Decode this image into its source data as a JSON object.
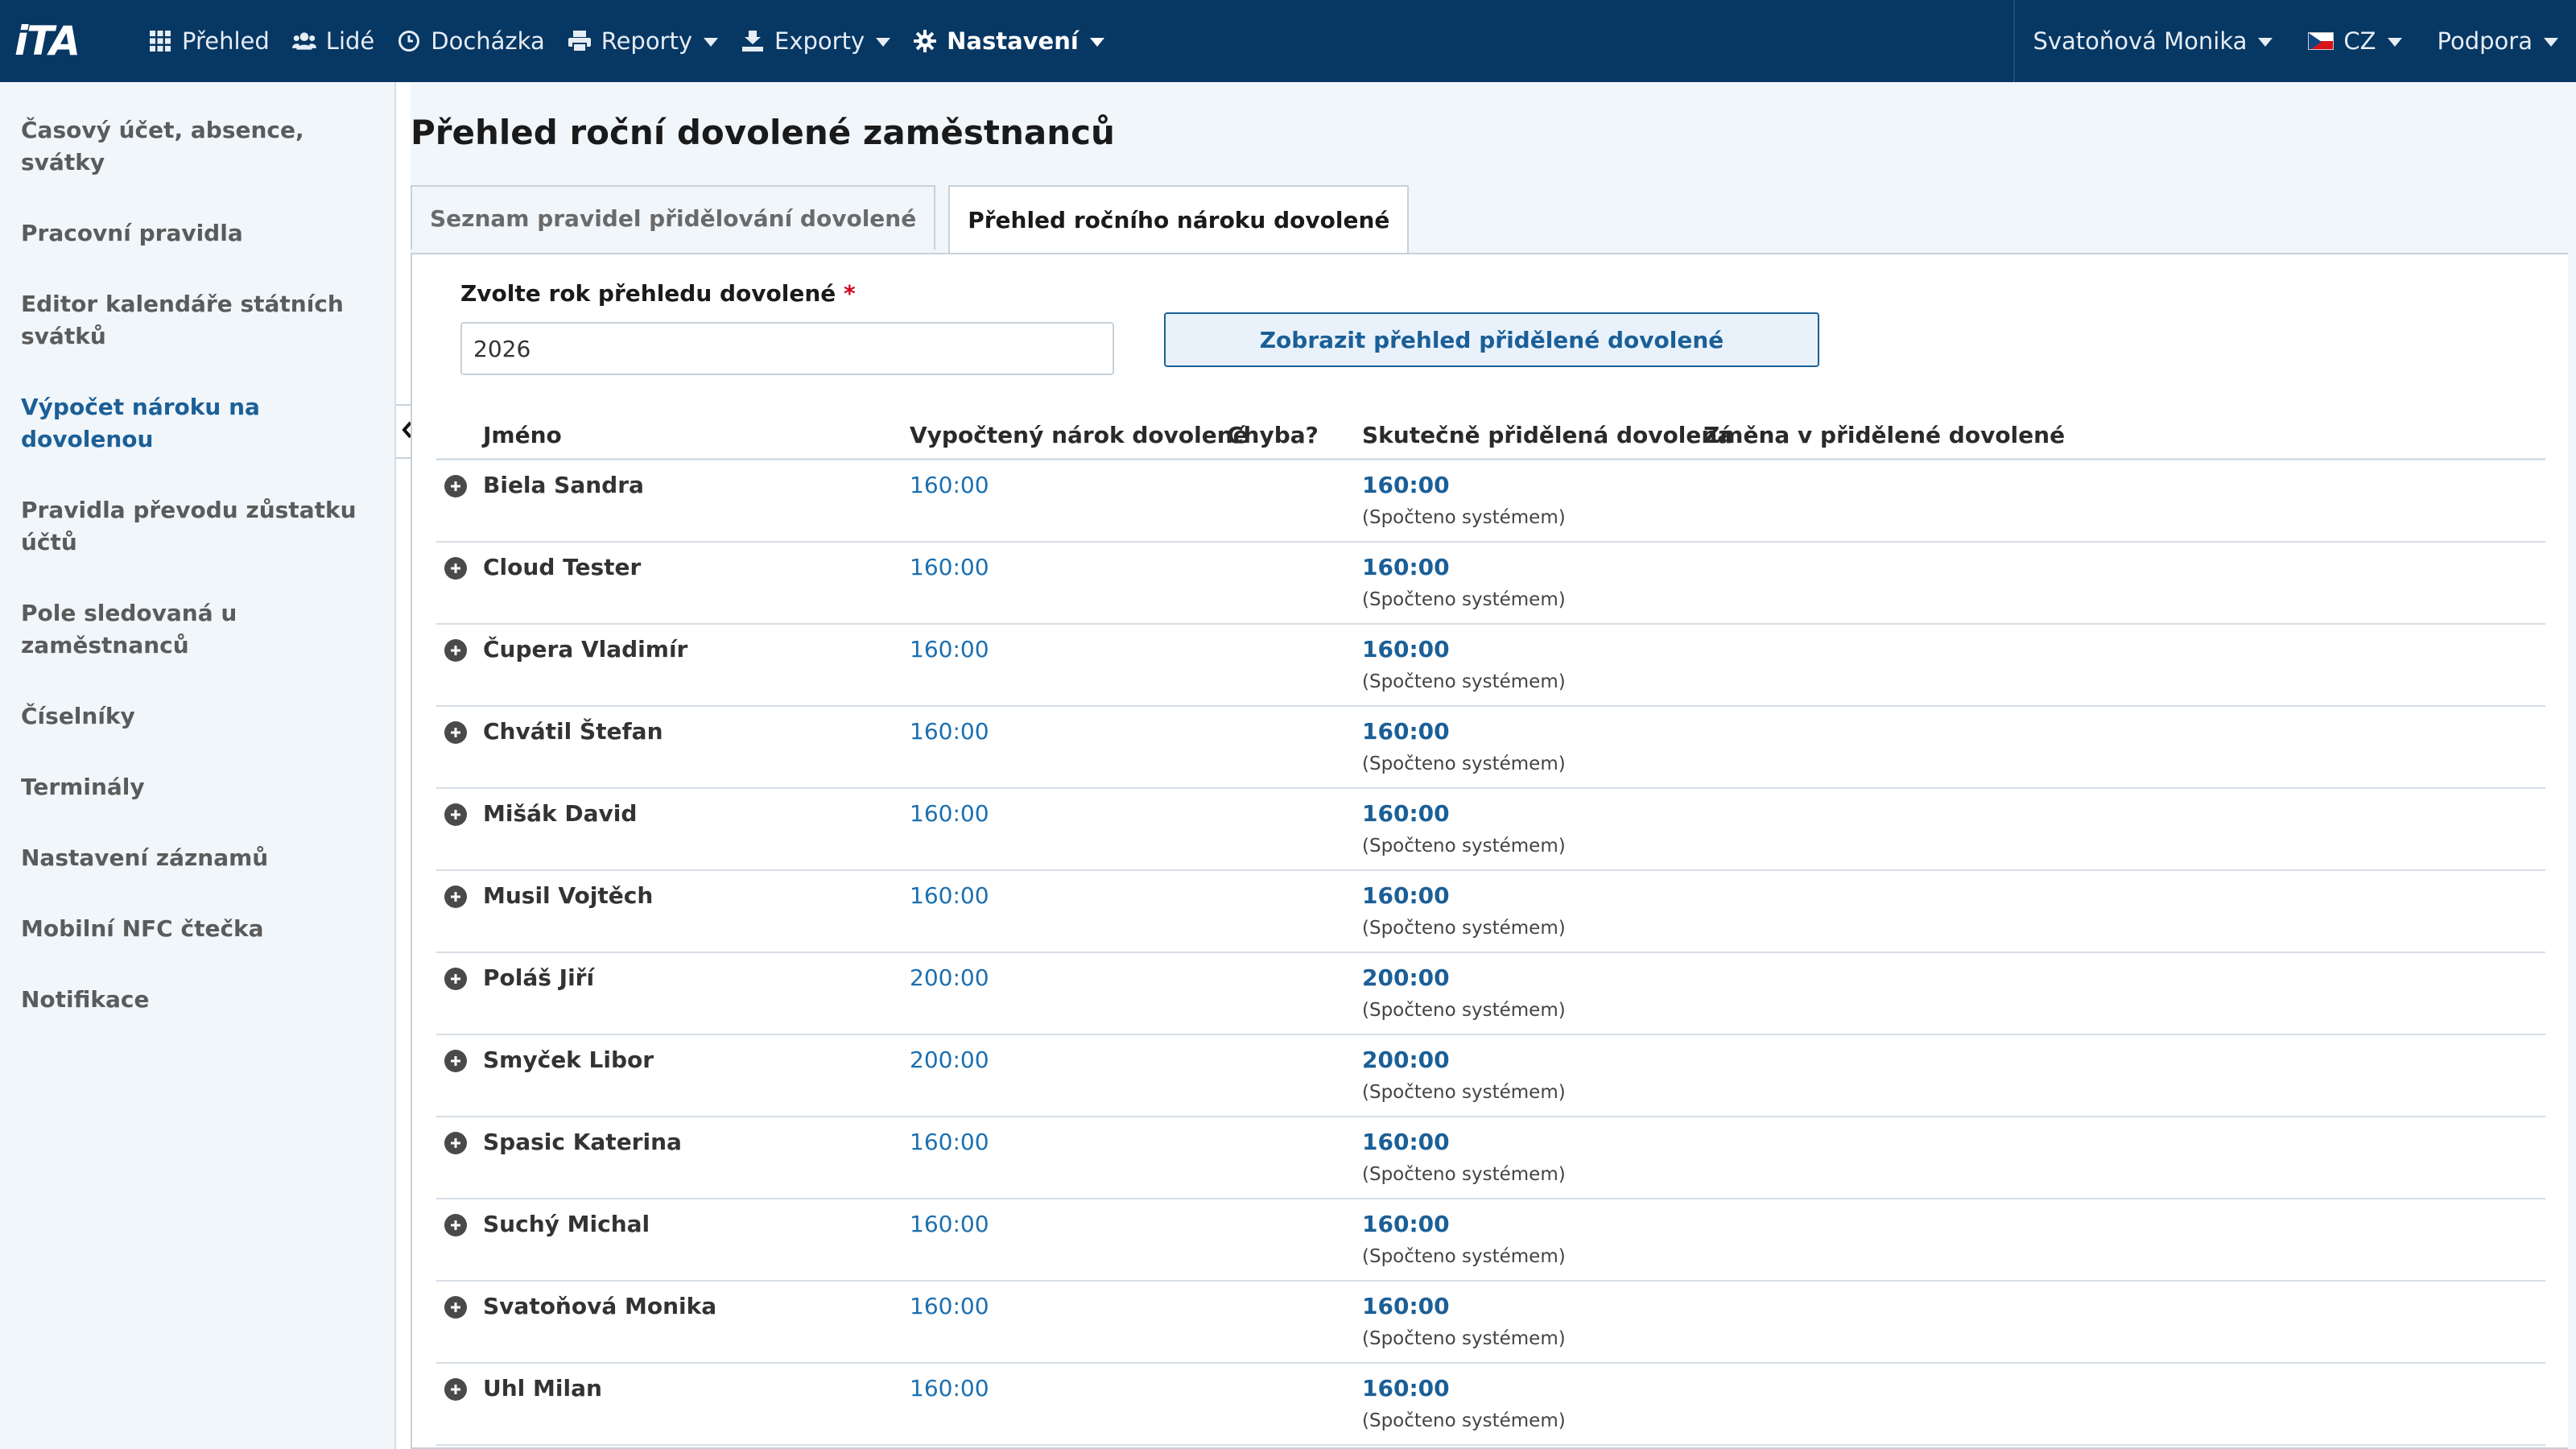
{
  "app": {
    "logo": "iTA"
  },
  "topnav": {
    "items": [
      {
        "label": "Přehled",
        "icon": "grid-icon"
      },
      {
        "label": "Lidé",
        "icon": "users-icon"
      },
      {
        "label": "Docházka",
        "icon": "clock-icon"
      },
      {
        "label": "Reporty",
        "icon": "printer-icon"
      },
      {
        "label": "Exporty",
        "icon": "export-icon"
      },
      {
        "label": "Nastavení",
        "icon": "gear-icon"
      }
    ],
    "user": "Svatoňová Monika",
    "language": "CZ",
    "support": "Podpora"
  },
  "sidebar": {
    "items": [
      {
        "label": "Časový účet, absence, svátky"
      },
      {
        "label": "Pracovní pravidla"
      },
      {
        "label": "Editor kalendáře státních svátků"
      },
      {
        "label": "Výpočet nároku na dovolenou"
      },
      {
        "label": "Pravidla převodu zůstatku účtů"
      },
      {
        "label": "Pole sledovaná u zaměstnanců"
      },
      {
        "label": "Číselníky"
      },
      {
        "label": "Terminály"
      },
      {
        "label": "Nastavení záznamů"
      },
      {
        "label": "Mobilní NFC čtečka"
      },
      {
        "label": "Notifikace"
      }
    ]
  },
  "main": {
    "title": "Přehled roční dovolené zaměstnanců",
    "tabs": [
      {
        "label": "Seznam pravidel přidělování dovolené"
      },
      {
        "label": "Přehled ročního nároku dovolené"
      }
    ],
    "form": {
      "year_label": "Zvolte rok přehledu dovolené",
      "required_mark": "*",
      "year_value": "2026",
      "show_button": "Zobrazit přehled přidělené dovolené"
    },
    "table": {
      "headers": {
        "name": "Jméno",
        "calculated": "Vypočtený nárok dovolené",
        "error": "Chyba?",
        "actual": "Skutečně přidělená dovolená",
        "change": "Změna v přidělené dovolené"
      },
      "rows": [
        {
          "name": "Biela Sandra",
          "calculated": "160:00",
          "actual": "160:00",
          "note": "(Spočteno systémem)"
        },
        {
          "name": "Cloud Tester",
          "calculated": "160:00",
          "actual": "160:00",
          "note": "(Spočteno systémem)"
        },
        {
          "name": "Čupera Vladimír",
          "calculated": "160:00",
          "actual": "160:00",
          "note": "(Spočteno systémem)"
        },
        {
          "name": "Chvátil Štefan",
          "calculated": "160:00",
          "actual": "160:00",
          "note": "(Spočteno systémem)"
        },
        {
          "name": "Mišák David",
          "calculated": "160:00",
          "actual": "160:00",
          "note": "(Spočteno systémem)"
        },
        {
          "name": "Musil Vojtěch",
          "calculated": "160:00",
          "actual": "160:00",
          "note": "(Spočteno systémem)"
        },
        {
          "name": "Poláš Jiří",
          "calculated": "200:00",
          "actual": "200:00",
          "note": "(Spočteno systémem)"
        },
        {
          "name": "Smyček Libor",
          "calculated": "200:00",
          "actual": "200:00",
          "note": "(Spočteno systémem)"
        },
        {
          "name": "Spasic Katerina",
          "calculated": "160:00",
          "actual": "160:00",
          "note": "(Spočteno systémem)"
        },
        {
          "name": "Suchý Michal",
          "calculated": "160:00",
          "actual": "160:00",
          "note": "(Spočteno systémem)"
        },
        {
          "name": "Svatoňová Monika",
          "calculated": "160:00",
          "actual": "160:00",
          "note": "(Spočteno systémem)"
        },
        {
          "name": "Uhl Milan",
          "calculated": "160:00",
          "actual": "160:00",
          "note": "(Spočteno systémem)"
        }
      ]
    }
  },
  "colors": {
    "topbar": "#073763",
    "accent": "#1b5f97",
    "link": "#1b6fb0",
    "background": "#f1f6fb"
  }
}
